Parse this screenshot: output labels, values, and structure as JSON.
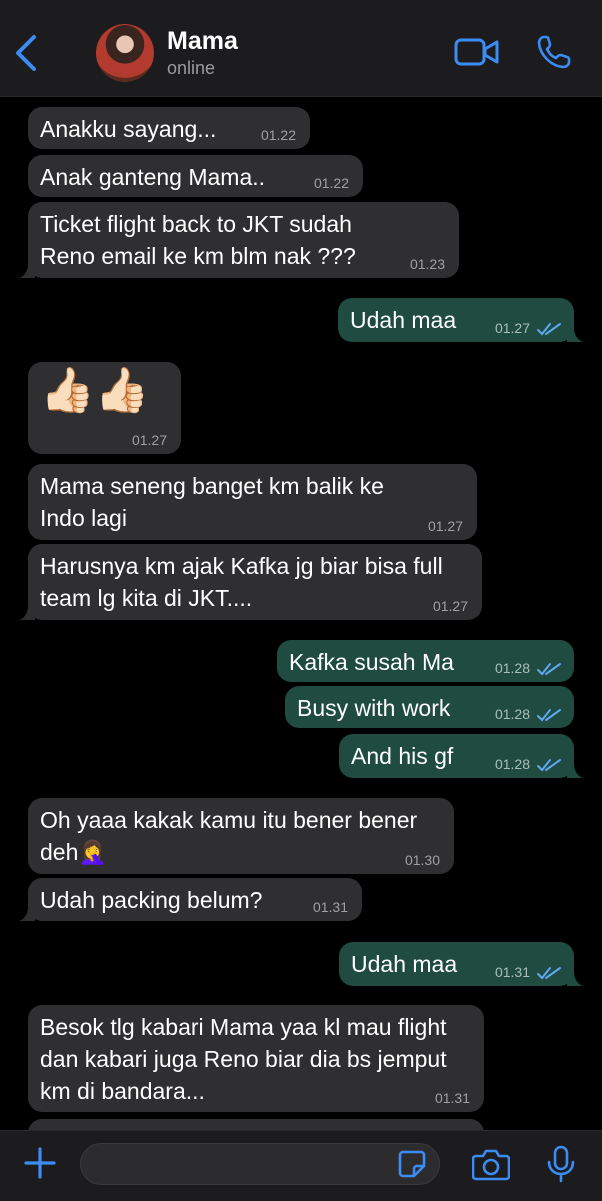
{
  "header": {
    "title": "Mama",
    "status": "online"
  },
  "colors": {
    "accent": "#3b8cf5",
    "incoming_bubble": "#2f2f31",
    "outgoing_bubble": "#1f4b40",
    "read_checks": "#5ea8f0"
  },
  "messages": [
    {
      "dir": "in",
      "text": "Anakku sayang...",
      "time": "01.22"
    },
    {
      "dir": "in",
      "text": "Anak ganteng Mama..",
      "time": "01.22"
    },
    {
      "dir": "in",
      "text": "Ticket flight back to JKT sudah Reno email ke km blm nak ???",
      "time": "01.23"
    },
    {
      "dir": "out",
      "text": "Udah maa",
      "time": "01.27"
    },
    {
      "dir": "in",
      "text": "👍🏻👍🏻",
      "time": "01.27"
    },
    {
      "dir": "in",
      "text": "Mama seneng banget km balik ke Indo lagi",
      "time": "01.27"
    },
    {
      "dir": "in",
      "text": "Harusnya km ajak Kafka jg biar bisa full team lg kita di JKT....",
      "time": "01.27"
    },
    {
      "dir": "out",
      "text": "Kafka susah Ma",
      "time": "01.28"
    },
    {
      "dir": "out",
      "text": "Busy with work",
      "time": "01.28"
    },
    {
      "dir": "out",
      "text": "And his gf",
      "time": "01.28"
    },
    {
      "dir": "in",
      "text": "Oh yaaa kakak kamu itu bener bener deh🤦‍♀️",
      "time": "01.30"
    },
    {
      "dir": "in",
      "text": "Udah packing belum?",
      "time": "01.31"
    },
    {
      "dir": "out",
      "text": "Udah maa",
      "time": "01.31"
    },
    {
      "dir": "in",
      "text": "Besok tlg kabari Mama yaa kl mau flight dan kabari juga Reno biar dia bs jemput km di bandara...",
      "time": "01.31"
    }
  ],
  "composer": {
    "placeholder": ""
  }
}
